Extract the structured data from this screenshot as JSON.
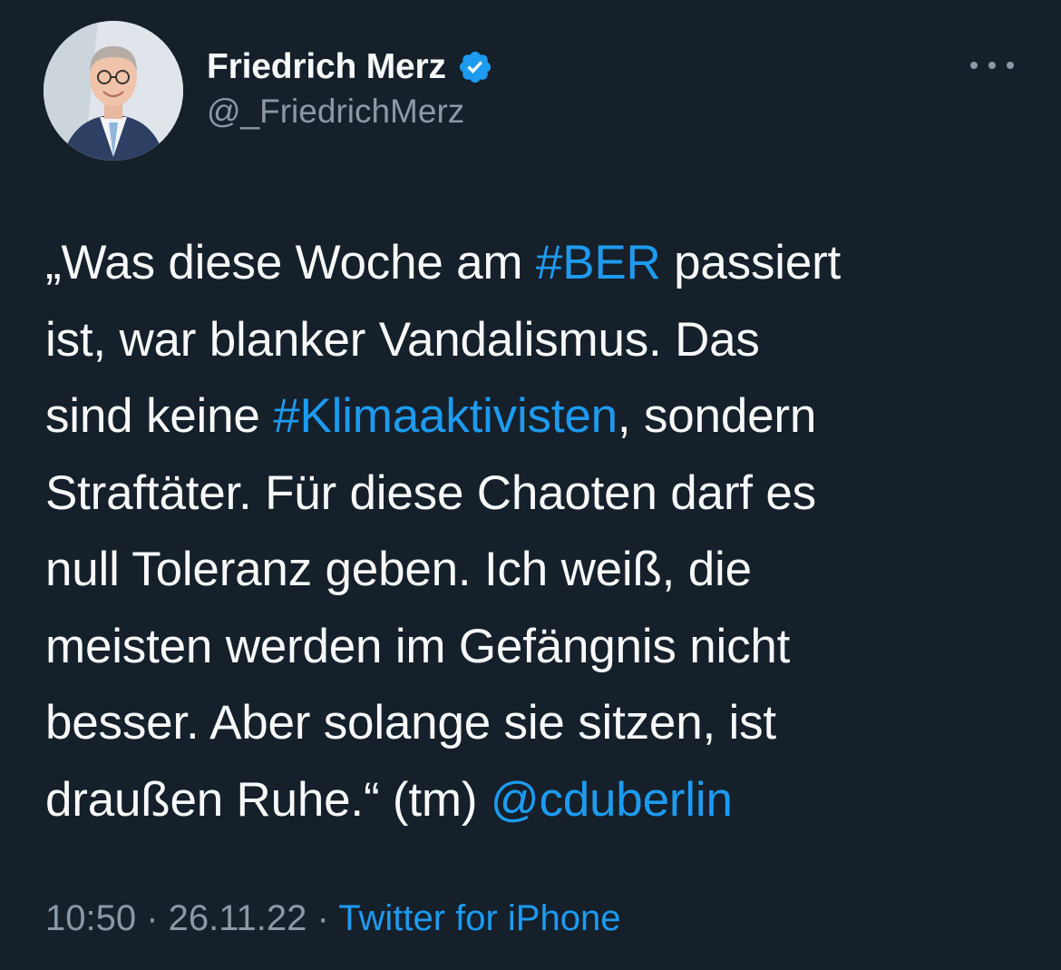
{
  "author": {
    "display_name": "Friedrich Merz",
    "handle": "@_FriedrichMerz",
    "verified_icon": "verified-badge-icon",
    "avatar_icon": "avatar-photo"
  },
  "menu": {
    "icon": "more-horizontal-icon"
  },
  "tweet": {
    "lines": [
      [
        {
          "t": "„Was diese Woche am "
        },
        {
          "t": "#BER",
          "link": true
        },
        {
          "t": " passiert"
        }
      ],
      [
        {
          "t": "ist, war blanker Vandalismus. Das"
        }
      ],
      [
        {
          "t": "sind keine "
        },
        {
          "t": "#Klimaaktivisten",
          "link": true
        },
        {
          "t": ", sondern"
        }
      ],
      [
        {
          "t": "Straftäter. Für diese Chaoten darf es"
        }
      ],
      [
        {
          "t": "null Toleranz geben. Ich weiß, die"
        }
      ],
      [
        {
          "t": "meisten werden im Gefängnis nicht"
        }
      ],
      [
        {
          "t": "besser. Aber solange sie sitzen, ist"
        }
      ],
      [
        {
          "t": "draußen Ruhe.“ (tm) "
        },
        {
          "t": "@cduberlin",
          "link": true
        }
      ]
    ]
  },
  "meta": {
    "time": "10:50",
    "separator": " · ",
    "date": "26.11.22",
    "source": "Twitter for iPhone"
  },
  "colors": {
    "background": "#15202b",
    "text": "#f7f9f9",
    "secondary": "#8b98a5",
    "accent": "#1d9bf0"
  }
}
